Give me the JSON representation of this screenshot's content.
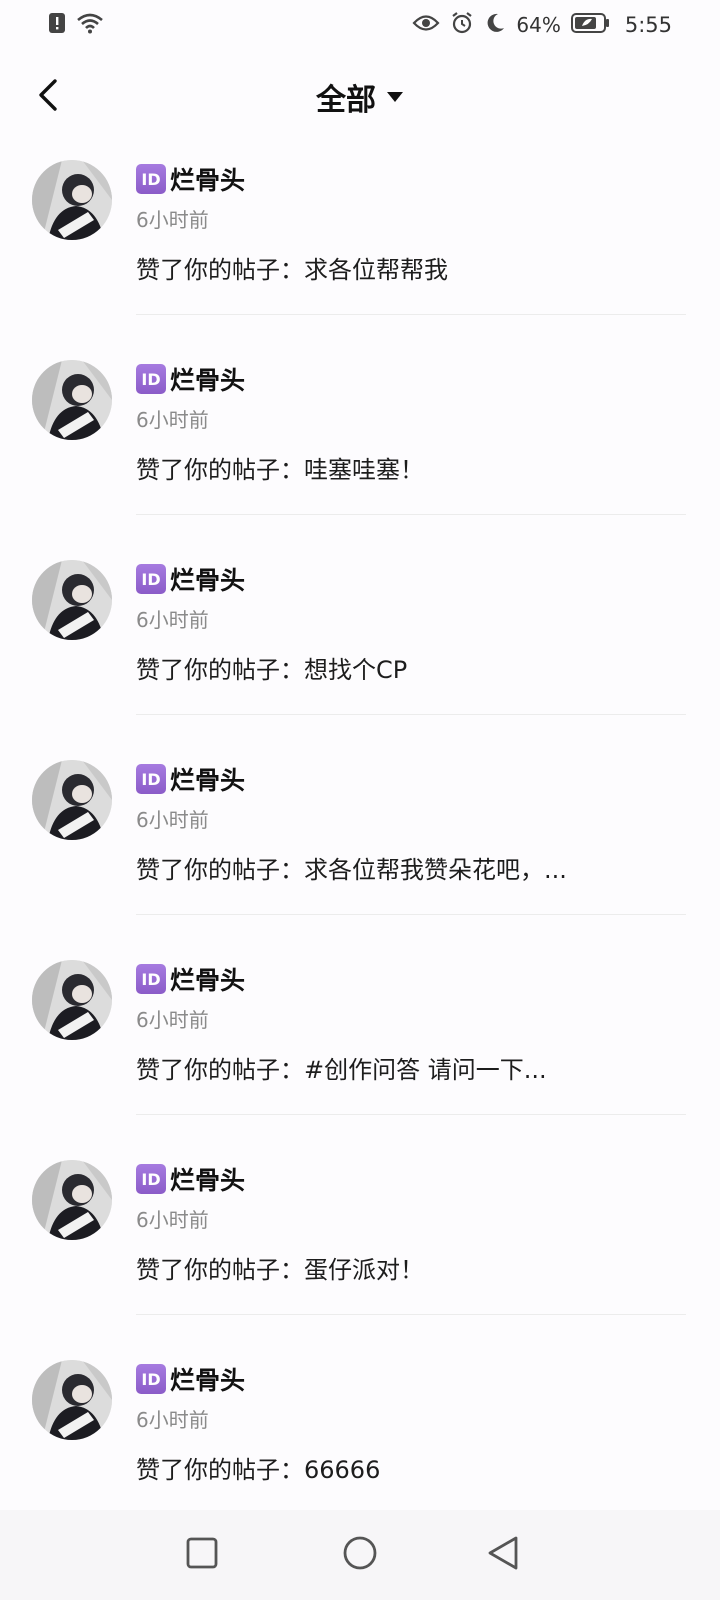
{
  "status_bar": {
    "battery_percent": "64%",
    "time": "5:55",
    "icons": [
      "alert-icon",
      "wifi-icon",
      "eye-icon",
      "alarm-icon",
      "moon-icon",
      "battery-icon"
    ]
  },
  "header": {
    "title": "全部",
    "back_icon": "chevron-left-icon",
    "dropdown_icon": "caret-down-icon"
  },
  "notifications": [
    {
      "badge": "ID",
      "username": "烂骨头",
      "time": "6小时前",
      "content": "赞了你的帖子：求各位帮帮我"
    },
    {
      "badge": "ID",
      "username": "烂骨头",
      "time": "6小时前",
      "content": "赞了你的帖子：哇塞哇塞！"
    },
    {
      "badge": "ID",
      "username": "烂骨头",
      "time": "6小时前",
      "content": "赞了你的帖子：想找个CP"
    },
    {
      "badge": "ID",
      "username": "烂骨头",
      "time": "6小时前",
      "content": "赞了你的帖子：求各位帮我赞朵花吧，..."
    },
    {
      "badge": "ID",
      "username": "烂骨头",
      "time": "6小时前",
      "content": "赞了你的帖子：#创作问答 请问一下..."
    },
    {
      "badge": "ID",
      "username": "烂骨头",
      "time": "6小时前",
      "content": "赞了你的帖子：蛋仔派对！"
    },
    {
      "badge": "ID",
      "username": "烂骨头",
      "time": "6小时前",
      "content": "赞了你的帖子：66666"
    }
  ],
  "nav_bar": {
    "icons": [
      "recent-apps-icon",
      "home-icon",
      "back-triangle-icon"
    ]
  }
}
